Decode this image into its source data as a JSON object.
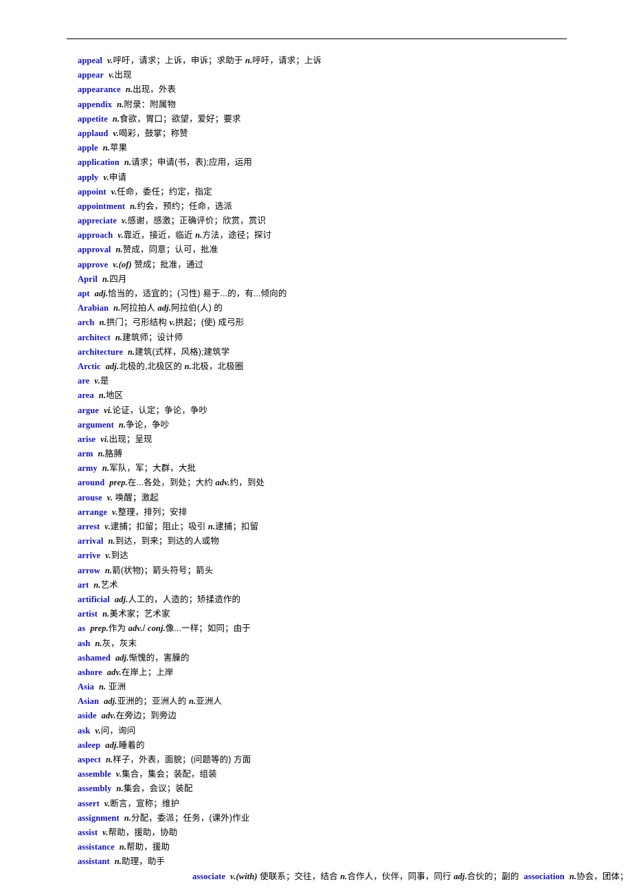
{
  "document": {
    "type": "vocabulary-list",
    "language_pair": "English-Chinese",
    "has_header_rule": true,
    "headword_color": "#1111CC",
    "gloss_color": "#000000"
  },
  "entries": [
    {
      "word": "appeal",
      "body": "v.呼吁，请求；上诉，申诉；求助于 n.呼吁，请求；上诉",
      "indent": false
    },
    {
      "word": "appear",
      "body": "v.出现",
      "indent": false
    },
    {
      "word": "appearance",
      "body": "n.出现，外表",
      "indent": false
    },
    {
      "word": "appendix",
      "body": "n.附录：附属物",
      "indent": false
    },
    {
      "word": "appetite",
      "body": "n.食欲，胃口；欲望，爱好；要求",
      "indent": false
    },
    {
      "word": "applaud",
      "body": "v.喝彩，鼓掌；称赞",
      "indent": false
    },
    {
      "word": "apple",
      "body": "n.苹果",
      "indent": false
    },
    {
      "word": "application",
      "body": "n.请求；申请(书，表);应用，运用",
      "indent": false
    },
    {
      "word": "apply",
      "body": "v.申请",
      "indent": false
    },
    {
      "word": "appoint",
      "body": "v.任命，委任；约定，指定",
      "indent": false
    },
    {
      "word": "appointment",
      "body": "n.约会，预约；任命，选派",
      "indent": false
    },
    {
      "word": "appreciate",
      "body": "v.感谢，感激；正确评价；欣赏，赏识",
      "indent": false
    },
    {
      "word": "approach",
      "body": "v.靠近，接近，临近 n.方法，途径；探讨",
      "indent": false
    },
    {
      "word": "approval",
      "body": "n.赞成，同意；认可，批准",
      "indent": false
    },
    {
      "word": "approve",
      "body": "v.(of) 赞成；批准，通过",
      "indent": false
    },
    {
      "word": "April",
      "body": "n.四月",
      "indent": false
    },
    {
      "word": "apt",
      "body": "adj.恰当的，适宜的；(习性) 易于...的，有...倾向的",
      "indent": false
    },
    {
      "word": "Arabian",
      "body": "n.阿拉拍人 adj.阿拉伯(人) 的",
      "indent": false
    },
    {
      "word": "arch",
      "body": "n.拱门；弓形结构 v.拱起；(使) 成弓形",
      "indent": false
    },
    {
      "word": "architect",
      "body": "n.建筑师；设计师",
      "indent": false
    },
    {
      "word": "architecture",
      "body": "n.建筑(式样，风格);建筑学",
      "indent": false
    },
    {
      "word": "Arctic",
      "body": "adj.北极的,北极区的 n.北极，北极圈",
      "indent": false
    },
    {
      "word": "are",
      "body": "v.是",
      "indent": false
    },
    {
      "word": "area",
      "body": "n.地区",
      "indent": false
    },
    {
      "word": "argue",
      "body": "vi.论证，认定；争论，争吵",
      "indent": false
    },
    {
      "word": "argument",
      "body": "n.争论，争吵",
      "indent": false
    },
    {
      "word": "arise",
      "body": "vi.出现；呈现",
      "indent": false
    },
    {
      "word": "arm",
      "body": "n.胳膊",
      "indent": false
    },
    {
      "word": "army",
      "body": "n.军队，军；大群，大批",
      "indent": false
    },
    {
      "word": "around",
      "body": "prep.在...各处，到处；大约 adv.约，到处",
      "indent": false
    },
    {
      "word": "arouse",
      "body": "v. 唤醒；激起",
      "indent": false
    },
    {
      "word": "arrange",
      "body": "v.整理，排列；安排",
      "indent": false
    },
    {
      "word": "arrest",
      "body": "v.逮捕；扣留；阻止；吸引 n.逮捕；扣留",
      "indent": false
    },
    {
      "word": "arrival",
      "body": "n.到达，到来；到达的人或物",
      "indent": false
    },
    {
      "word": "arrive",
      "body": "v.到达",
      "indent": false
    },
    {
      "word": "arrow",
      "body": "n.箭(状物)；箭头符号；箭头",
      "indent": false
    },
    {
      "word": "art",
      "body": "n.艺术",
      "indent": false
    },
    {
      "word": "artificial",
      "body": "adj.人工的，人造的；矫揉造作的",
      "indent": false
    },
    {
      "word": "artist",
      "body": "n.美术家；艺术家",
      "indent": false
    },
    {
      "word": "as",
      "body": "prep.作为 adv./ conj.像...一样；如同；由于",
      "indent": false
    },
    {
      "word": "ash",
      "body": "n.灰，灰末",
      "indent": false
    },
    {
      "word": "ashamed",
      "body": "adj.惭愧的，害臊的",
      "indent": false
    },
    {
      "word": "ashore",
      "body": "adv.在岸上；上岸",
      "indent": false
    },
    {
      "word": "Asia",
      "body": "n. 亚洲",
      "indent": false
    },
    {
      "word": "Asian",
      "body": "adj.亚洲的；亚洲人的 n.亚洲人",
      "indent": false
    },
    {
      "word": "aside",
      "body": "adv.在旁边；到旁边",
      "indent": false
    },
    {
      "word": "ask",
      "body": "v.问，询问",
      "indent": false
    },
    {
      "word": "asleep",
      "body": "adj.睡着的",
      "indent": false
    },
    {
      "word": "aspect",
      "body": "n.样子，外表，面貌；(问题等的) 方面",
      "indent": false
    },
    {
      "word": "assemble",
      "body": "v.集合，集会；装配，组装",
      "indent": false
    },
    {
      "word": "assembly",
      "body": "n.集会，会议；装配",
      "indent": false
    },
    {
      "word": "assert",
      "body": "v.断言，宣称；维护",
      "indent": false
    },
    {
      "word": "assignment",
      "body": "n.分配，委派；任务，(课外)作业",
      "indent": false
    },
    {
      "word": "assist",
      "body": "v.帮助，援助，协助",
      "indent": false
    },
    {
      "word": "assistance",
      "body": "n.帮助，援助",
      "indent": false
    },
    {
      "word": "assistant",
      "body": "n.助理，助手",
      "indent": false
    },
    {
      "word": "associate",
      "body": "v.(with) 使联系；交往，结合 n.合作人，伙伴，同事，同行 adj.合伙的；副的",
      "indent": true,
      "word2": "association",
      "body2": "n.协会，团体；"
    }
  ]
}
